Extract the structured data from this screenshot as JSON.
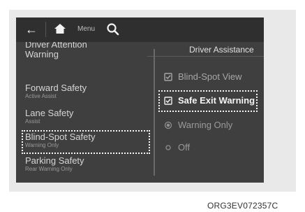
{
  "topbar": {
    "back_icon": "arrow-left-icon",
    "home_icon": "home-icon",
    "menu_label": "Menu",
    "search_icon": "search-icon"
  },
  "header": {
    "title": "Driver Assistance"
  },
  "left_list": [
    {
      "label": "Driver Attention Warning",
      "sublabel": ""
    },
    {
      "label": "Forward Safety",
      "sublabel": "Active Assist"
    },
    {
      "label": "Lane Safety",
      "sublabel": "Assist"
    },
    {
      "label": "Blind-Spot Safety",
      "sublabel": "Warning Only",
      "highlighted": true
    },
    {
      "label": "Parking Safety",
      "sublabel": "Rear Warning Only"
    }
  ],
  "right_list": [
    {
      "label": "Blind-Spot View",
      "control": "checkbox",
      "checked": true
    },
    {
      "label": "Safe Exit Warning",
      "control": "checkbox",
      "checked": true,
      "highlighted": true
    },
    {
      "label": "Warning Only",
      "control": "radio",
      "selected": true
    },
    {
      "label": "Off",
      "control": "radio",
      "selected": false
    }
  ],
  "caption": "ORG3EV072357C"
}
